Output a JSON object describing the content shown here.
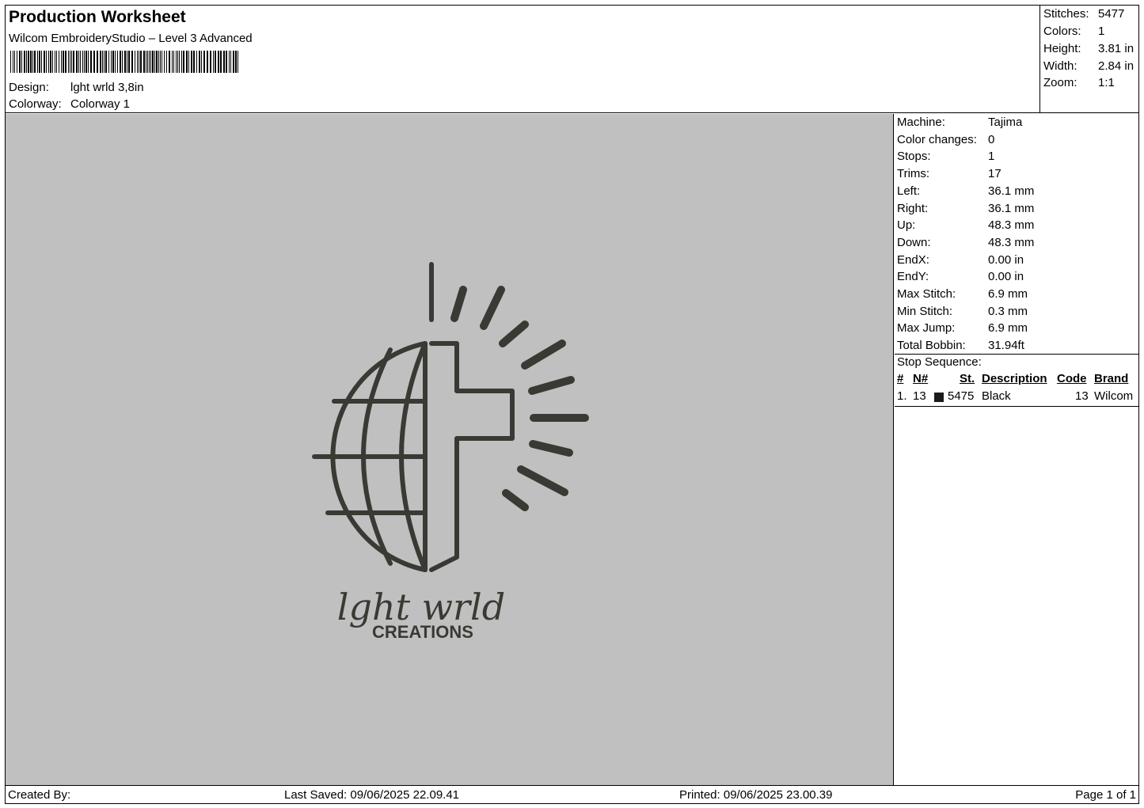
{
  "header": {
    "title": "Production Worksheet",
    "subtitle": "Wilcom EmbroideryStudio – Level 3 Advanced",
    "design_label": "Design:",
    "design_value": "lght wrld 3,8in",
    "colorway_label": "Colorway:",
    "colorway_value": "Colorway 1"
  },
  "summary": {
    "stitches_label": "Stitches:",
    "stitches_value": "5477",
    "colors_label": "Colors:",
    "colors_value": "1",
    "height_label": "Height:",
    "height_value": "3.81 in",
    "width_label": "Width:",
    "width_value": "2.84 in",
    "zoom_label": "Zoom:",
    "zoom_value": "1:1"
  },
  "machine_info": [
    {
      "label": "Machine:",
      "value": "Tajima"
    },
    {
      "label": "Color changes:",
      "value": "0"
    },
    {
      "label": "Stops:",
      "value": "1"
    },
    {
      "label": "Trims:",
      "value": "17"
    },
    {
      "label": "Left:",
      "value": "36.1 mm"
    },
    {
      "label": "Right:",
      "value": "36.1 mm"
    },
    {
      "label": "Up:",
      "value": "48.3 mm"
    },
    {
      "label": "Down:",
      "value": "48.3 mm"
    },
    {
      "label": "EndX:",
      "value": "0.00 in"
    },
    {
      "label": "EndY:",
      "value": "0.00 in"
    },
    {
      "label": "Max Stitch:",
      "value": "6.9 mm"
    },
    {
      "label": "Min Stitch:",
      "value": "0.3 mm"
    },
    {
      "label": "Max Jump:",
      "value": "6.9 mm"
    },
    {
      "label": "Total Bobbin:",
      "value": "31.94ft"
    }
  ],
  "stop_sequence": {
    "title": "Stop Sequence:",
    "headers": {
      "num": "#",
      "n": "N#",
      "st": "St.",
      "description": "Description",
      "code": "Code",
      "brand": "Brand"
    },
    "rows": [
      {
        "num": "1.",
        "n": "13",
        "swatch_color": "#1b1b1b",
        "st": "5475",
        "description": "Black",
        "code": "13",
        "brand": "Wilcom"
      }
    ]
  },
  "design_preview": {
    "background_color": "#c0c0c0",
    "thread_color": "#3a3a34",
    "script_text": "lght wrld",
    "block_text": "CREATIONS"
  },
  "footer": {
    "created_by": "Created By:",
    "last_saved": "Last Saved: 09/06/2025 22.09.41",
    "printed": "Printed: 09/06/2025 23.00.39",
    "page": "Page 1 of 1"
  }
}
